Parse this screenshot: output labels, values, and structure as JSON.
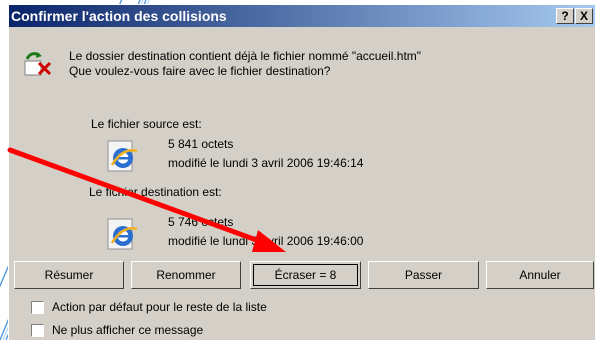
{
  "dialog": {
    "title": "Confirmer l'action des collisions",
    "help_label": "?",
    "close_label": "X",
    "message_line1": "Le dossier destination contient déjà le fichier nommé \"accueil.htm\"",
    "message_line2": "Que voulez-vous faire avec le fichier destination?"
  },
  "source": {
    "label": "Le fichier source est:",
    "size": "5 841 octets",
    "modified": "modifié le lundi 3 avril 2006 19:46:14"
  },
  "destination": {
    "label": "Le fichier destination est:",
    "size": "5 746 octets",
    "modified": "modifié le lundi 3 avril 2006 19:46:00"
  },
  "buttons": {
    "resume": "Résumer",
    "rename": "Renommer",
    "overwrite": "Écraser = 8",
    "skip": "Passer",
    "cancel": "Annuler"
  },
  "options": {
    "default_action": "Action par défaut pour le reste de la liste",
    "no_show": "Ne plus afficher ce message"
  },
  "colors": {
    "title_start": "#0a246a",
    "title_end": "#a6caf0",
    "arrow": "#ff0000",
    "dialog_bg": "#d4d0c8"
  },
  "icons": {
    "message": "copy-conflict-icon",
    "file": "internet-explorer-document-icon"
  }
}
